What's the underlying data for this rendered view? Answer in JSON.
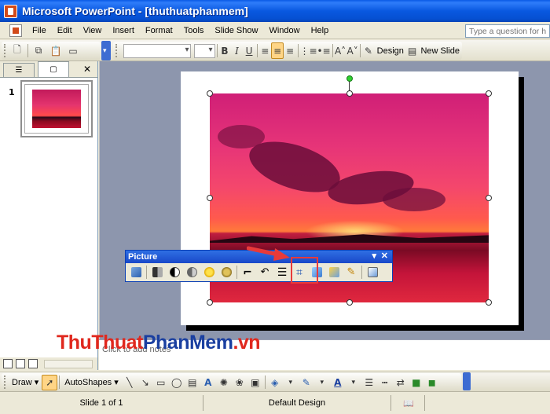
{
  "window": {
    "title": "Microsoft PowerPoint - [thuthuatphanmem]"
  },
  "menu": {
    "items": [
      "File",
      "Edit",
      "View",
      "Insert",
      "Format",
      "Tools",
      "Slide Show",
      "Window",
      "Help"
    ]
  },
  "help_search": {
    "placeholder": "Type a question for help"
  },
  "toolbar": {
    "design_label": "Design",
    "new_slide_label": "New Slide"
  },
  "slides_pane": {
    "slide_number": "1"
  },
  "picture_toolbar": {
    "title": "Picture"
  },
  "watermark": {
    "part1": "ThuThuat",
    "part2": "PhanMem",
    "part3": ".vn"
  },
  "notes": {
    "placeholder": "Click to add notes"
  },
  "drawing_toolbar": {
    "draw_label": "Draw",
    "autoshapes_label": "AutoShapes"
  },
  "status": {
    "slide_position": "Slide 1 of 1",
    "design_name": "Default Design"
  },
  "colors": {
    "titlebar": "#0958e0",
    "highlight": "#e83a3a",
    "watermark_red": "#e0281e",
    "watermark_blue": "#1a3fa0"
  }
}
